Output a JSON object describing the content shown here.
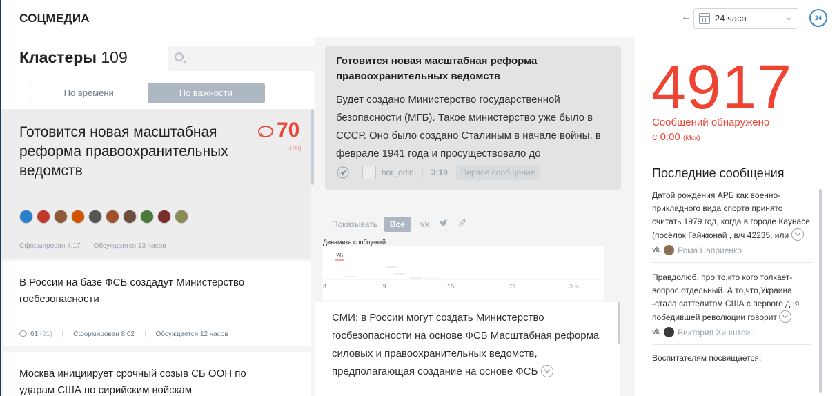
{
  "header": {
    "brand": "СОЦМЕДИА",
    "period": "24 часа",
    "live_badge": "24"
  },
  "clusters": {
    "title": "Кластеры",
    "count": "109",
    "search_placeholder": "",
    "sort_tabs": [
      "По времени",
      "По важности"
    ],
    "active_sort": "По важности",
    "items": [
      {
        "title": "Готовится новая масштабная реформа правоохранительных ведомств",
        "count": "70",
        "count_sub": "(70)",
        "formed": "Сформирован 4:17",
        "discussed": "Обсуждается 13 часов",
        "source_avatars": [
          "#2a7fc9",
          "#c0392b",
          "#8e5a3a",
          "#d35400",
          "#555555",
          "#a0522d",
          "#6b4e3d",
          "#4a7a3a",
          "#7a2e2e",
          "#8a8a55"
        ]
      },
      {
        "title": "В России на базе ФСБ создадут Министерство госбезопасности",
        "count": "61",
        "count_sub": "(61)",
        "formed": "Сформирован 8:02",
        "discussed": "Обсуждается 12 часов"
      },
      {
        "title": "Москва инициирует срочный созыв СБ ООН по ударам США по сирийским войскам"
      }
    ]
  },
  "message": {
    "title": "Готовится новая масштабная реформа правоохранительных ведомств",
    "body": "Будет создано Министерство государственной безопасности (МГБ). Такое министерство уже было в СССР. Оно было создано Сталиным в начале войны, в феврале 1941 года и просуществовало до",
    "author": "bor_odin",
    "time": "3:19",
    "first_label": "Первое сообщение"
  },
  "filter": {
    "label": "Показывать",
    "all": "Все",
    "vk": "vk",
    "twitter": "twitter-icon",
    "attach": "attach-icon"
  },
  "dynamics": {
    "title": "Динамика сообщений",
    "peak_label": "26",
    "x_ticks": [
      "3",
      "9",
      "15",
      "21",
      "3 ч"
    ]
  },
  "stream": {
    "text": "СМИ: в России могут создать Министерство госбезопасности на основе ФСБ Масштабная реформа силовых и правоохранительных ведомств, предполагающая создание на основе ФСБ"
  },
  "stats": {
    "total": "4917",
    "label_line1": "Сообщений обнаружено",
    "label_line2": "с 0:00",
    "tz": "(Мск)"
  },
  "latest": {
    "title": "Последние сообщения",
    "items": [
      {
        "text": "Датой рождения АРБ как военно-прикладного вида спорта принято считать 1979 год, когда в городе Каунасе (посёлок Гайжюнай , в/ч 42235, или",
        "network": "vk",
        "author": "Рома Наприенко"
      },
      {
        "text": "Правдолюб, про то,кто кого толкает-вопрос отдельный. А то,что,Украина -стала саттелитом США с первого дня победившей революции говорит",
        "network": "vk",
        "author": "Виктория Хинштейн"
      }
    ],
    "partial_text": "Воспитателям посвящается:"
  }
}
